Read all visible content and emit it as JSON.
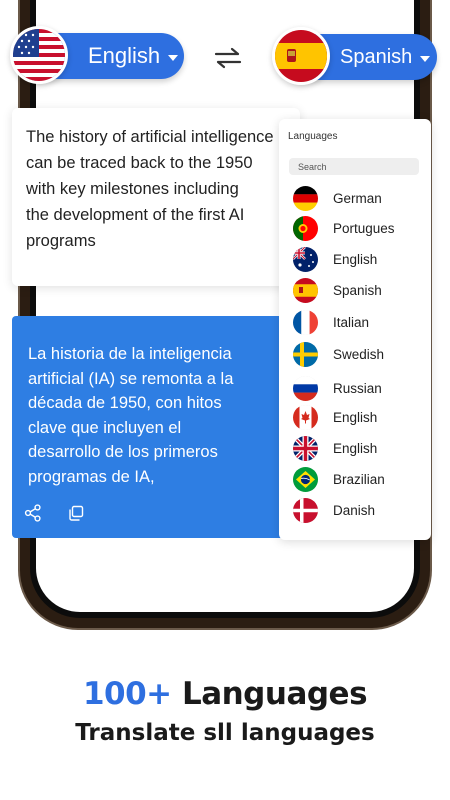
{
  "source_language": {
    "label": "English",
    "flag": "us-flag"
  },
  "target_language": {
    "label": "Spanish",
    "flag": "es-flag"
  },
  "swap_icon": "swap-arrows-icon",
  "source_text": "The history of artificial intelligence\ncan be traced back to the 1950\nwith key milestones including\nthe development of the first AI\nprograms",
  "translated_text": "La historia de la inteligencia\nartificial (IA) se remonta a la\ndécada de 1950, con hitos\nclave que incluyen el\ndesarrollo de los primeros\nprogramas de IA,",
  "actions": {
    "share_icon": "share-icon",
    "copy_icon": "copy-icon"
  },
  "languages_panel": {
    "title": "Languages",
    "search_placeholder": "Search",
    "items": [
      {
        "label": "German",
        "flag": "de"
      },
      {
        "label": "Portugues",
        "flag": "pt"
      },
      {
        "label": "English",
        "flag": "au"
      },
      {
        "label": "Spanish",
        "flag": "es"
      },
      {
        "label": "Italian",
        "flag": "fr"
      },
      {
        "label": "Swedish",
        "flag": "se"
      },
      {
        "label": "Russian",
        "flag": "ru"
      },
      {
        "label": "English",
        "flag": "ca"
      },
      {
        "label": "English",
        "flag": "uk"
      },
      {
        "label": "Brazilian",
        "flag": "br"
      },
      {
        "label": "Danish",
        "flag": "dk"
      }
    ]
  },
  "headline": {
    "accent": "100+",
    "rest": "Languages"
  },
  "subline": "Translate sll languages",
  "colors": {
    "accent": "#2e6fe0",
    "card": "#2e7ee3"
  }
}
